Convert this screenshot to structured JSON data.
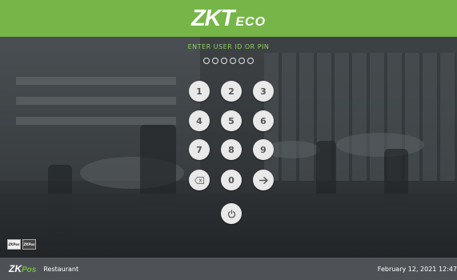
{
  "header": {
    "logo_zk": "ZK",
    "logo_t": "T",
    "logo_eco": "ECO"
  },
  "login": {
    "prompt": "ENTER USER ID OR PIN",
    "pin_length": 6,
    "keys": [
      {
        "label": "1"
      },
      {
        "label": "2"
      },
      {
        "label": "3"
      },
      {
        "label": "4"
      },
      {
        "label": "5"
      },
      {
        "label": "6"
      },
      {
        "label": "7"
      },
      {
        "label": "8"
      },
      {
        "label": "9"
      },
      {
        "icon": "backspace-icon"
      },
      {
        "label": "0"
      },
      {
        "icon": "arrow-right-icon"
      },
      {
        "icon": "power-icon"
      }
    ]
  },
  "badges": [
    "ZKPos",
    "ZKPos"
  ],
  "footer": {
    "brand_zk": "ZK",
    "brand_pos": "Pos",
    "app_name": "Restaurant",
    "datetime": "February 12, 2021 12:47"
  },
  "colors": {
    "accent": "#76b649",
    "footer": "#4e5257",
    "key": "#e9e9e9"
  }
}
